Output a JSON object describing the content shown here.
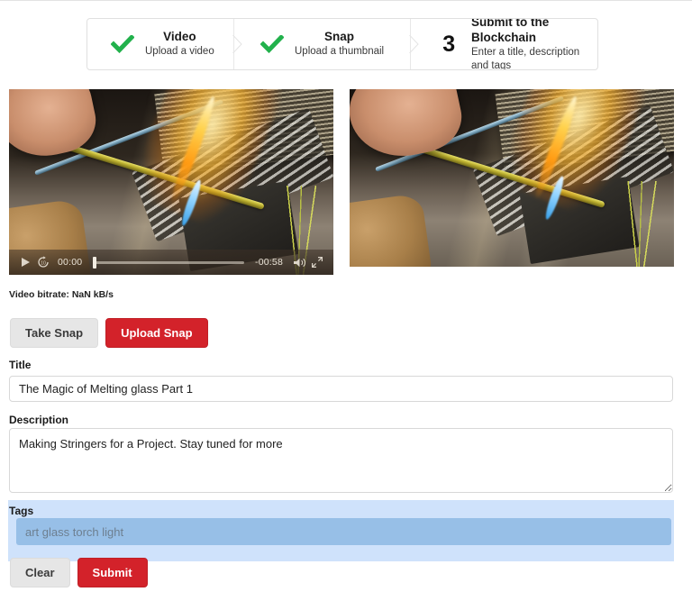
{
  "stepper": {
    "steps": [
      {
        "mark": "check-icon",
        "number": "",
        "title": "Video",
        "subtitle": "Upload a video",
        "state": "complete"
      },
      {
        "mark": "check-icon",
        "number": "",
        "title": "Snap",
        "subtitle": "Upload a thumbnail",
        "state": "complete"
      },
      {
        "mark": "number",
        "number": "3",
        "title": "Submit to the Blockchain",
        "subtitle": "Enter a title, description and tags",
        "state": "active"
      }
    ]
  },
  "video_player": {
    "play_icon": "play-icon",
    "rewind_icon": "rewind-10-icon",
    "current_time": "00:00",
    "remaining_time": "-00:58",
    "volume_icon": "volume-icon",
    "fullscreen_icon": "fullscreen-icon",
    "progress_percent": 0
  },
  "bitrate": {
    "text": "Video bitrate: NaN kB/s"
  },
  "snap_actions": {
    "take_snap_label": "Take Snap",
    "upload_snap_label": "Upload Snap"
  },
  "form": {
    "title": {
      "label": "Title",
      "value": "The Magic of Melting glass Part 1",
      "placeholder": "Title"
    },
    "description": {
      "label": "Description",
      "value": "Making Stringers for a Project. Stay tuned for more",
      "placeholder": "Description"
    },
    "tags": {
      "label": "Tags",
      "value": "",
      "placeholder": "art glass torch light"
    },
    "clear_label": "Clear",
    "submit_label": "Submit"
  },
  "colors": {
    "accent_red": "#d3222a",
    "check_green": "#22b14c",
    "selection_blue": "#cfe2fb",
    "tags_field_blue": "#97bfe7"
  }
}
